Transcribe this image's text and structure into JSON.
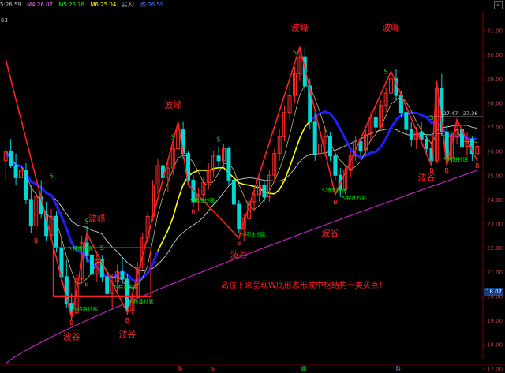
{
  "header": {
    "items": [
      {
        "label": "5:",
        "value": "26.59",
        "color": "#c8c8c8"
      },
      {
        "label": "M4:",
        "value": "26.07",
        "color": "#ff66ff"
      },
      {
        "label": "M5:",
        "value": "26.76",
        "color": "#00ff00"
      },
      {
        "label": "M6:",
        "value": "25.04",
        "color": "#ffff00"
      },
      {
        "label": "买入:",
        "value": "",
        "color": "#c8c8c8"
      },
      {
        "label": "跌:",
        "value": "26.59",
        "color": "#4d7dff"
      }
    ]
  },
  "corner_label": "63",
  "current_price_tag": "18.07",
  "colors": {
    "background": "#000000",
    "up_candle": "#ff2a2a",
    "down_candle": "#00d8d8",
    "zigzag": "#ff2020",
    "ma_blue": "#1e1eff",
    "ma_yellow": "#ffff00",
    "ma_white": "#cfcfcf",
    "ma_purple": "#c020c0",
    "annotation": "#ff2020",
    "signal_s": "#00ee00",
    "signal_b": "#ff3030"
  },
  "chart_data": {
    "type": "candlestick",
    "ylim": [
      17.4,
      31.8
    ],
    "yticks": [
      "31.00",
      "30.00",
      "29.00",
      "28.00",
      "27.00",
      "26.00",
      "25.00",
      "24.00",
      "23.00",
      "22.00",
      "21.00",
      "20.00",
      "19.00",
      "18.00",
      "17.00"
    ],
    "price_range_label": "27.47 - 27.36",
    "candles": [
      [
        25.6,
        26.2,
        24.8,
        26.0
      ],
      [
        26.0,
        26.5,
        25.3,
        25.4
      ],
      [
        25.4,
        25.9,
        24.6,
        24.9
      ],
      [
        24.9,
        25.4,
        24.2,
        25.2
      ],
      [
        25.2,
        25.5,
        23.8,
        24.0
      ],
      [
        24.0,
        24.6,
        22.6,
        22.9
      ],
      [
        22.9,
        24.4,
        22.7,
        24.1
      ],
      [
        24.1,
        24.8,
        23.2,
        23.4
      ],
      [
        23.4,
        23.9,
        22.3,
        22.5
      ],
      [
        22.5,
        23.6,
        22.4,
        23.3
      ],
      [
        23.3,
        23.5,
        21.8,
        22.0
      ],
      [
        22.0,
        22.4,
        20.6,
        20.8
      ],
      [
        20.8,
        21.5,
        19.5,
        19.7
      ],
      [
        19.7,
        20.1,
        19.0,
        19.3
      ],
      [
        19.3,
        20.9,
        19.2,
        20.7
      ],
      [
        20.7,
        22.5,
        20.5,
        22.2
      ],
      [
        22.2,
        22.9,
        21.4,
        21.7
      ],
      [
        21.7,
        22.0,
        20.7,
        20.9
      ],
      [
        20.9,
        21.8,
        20.6,
        21.5
      ],
      [
        21.5,
        21.7,
        20.6,
        20.8
      ],
      [
        20.8,
        21.0,
        19.9,
        20.1
      ],
      [
        20.1,
        20.9,
        19.5,
        20.6
      ],
      [
        20.6,
        21.3,
        20.2,
        21.0
      ],
      [
        21.0,
        21.6,
        20.5,
        20.7
      ],
      [
        20.7,
        20.9,
        19.2,
        19.4
      ],
      [
        19.4,
        20.2,
        19.2,
        20.0
      ],
      [
        20.0,
        21.4,
        19.9,
        21.2
      ],
      [
        21.2,
        22.6,
        21.1,
        22.4
      ],
      [
        22.4,
        23.5,
        22.2,
        23.3
      ],
      [
        23.3,
        24.8,
        23.1,
        24.6
      ],
      [
        24.6,
        25.7,
        24.2,
        25.4
      ],
      [
        25.4,
        26.1,
        24.6,
        24.9
      ],
      [
        24.9,
        25.6,
        24.3,
        25.3
      ],
      [
        25.3,
        26.4,
        25.0,
        26.1
      ],
      [
        26.1,
        27.1,
        25.8,
        26.9
      ],
      [
        26.9,
        27.2,
        25.7,
        25.9
      ],
      [
        25.9,
        26.0,
        24.6,
        24.8
      ],
      [
        24.8,
        25.0,
        23.7,
        23.9
      ],
      [
        23.9,
        24.5,
        23.5,
        24.2
      ],
      [
        24.2,
        24.9,
        23.9,
        24.7
      ],
      [
        24.7,
        25.5,
        24.4,
        25.2
      ],
      [
        25.2,
        26.0,
        24.9,
        25.8
      ],
      [
        25.8,
        26.2,
        25.3,
        25.6
      ],
      [
        25.6,
        26.3,
        25.4,
        26.1
      ],
      [
        26.1,
        26.2,
        24.6,
        24.8
      ],
      [
        24.8,
        24.9,
        23.6,
        23.8
      ],
      [
        23.8,
        24.0,
        22.6,
        22.8
      ],
      [
        22.8,
        23.4,
        22.3,
        23.2
      ],
      [
        23.2,
        24.1,
        23.0,
        23.9
      ],
      [
        23.9,
        24.4,
        23.5,
        24.2
      ],
      [
        24.2,
        24.9,
        23.9,
        24.6
      ],
      [
        24.6,
        24.8,
        23.9,
        24.1
      ],
      [
        24.1,
        25.2,
        23.9,
        25.0
      ],
      [
        25.0,
        26.1,
        24.8,
        25.9
      ],
      [
        25.9,
        26.9,
        25.6,
        26.6
      ],
      [
        26.6,
        27.9,
        26.4,
        27.6
      ],
      [
        27.6,
        28.6,
        27.3,
        28.3
      ],
      [
        28.3,
        29.5,
        28.0,
        29.2
      ],
      [
        29.2,
        30.2,
        28.9,
        29.9
      ],
      [
        29.9,
        30.3,
        28.4,
        28.7
      ],
      [
        28.7,
        29.0,
        26.9,
        27.2
      ],
      [
        27.2,
        27.6,
        25.6,
        25.9
      ],
      [
        25.9,
        26.6,
        25.4,
        26.3
      ],
      [
        26.3,
        26.9,
        25.8,
        26.6
      ],
      [
        26.6,
        26.8,
        25.6,
        25.8
      ],
      [
        25.8,
        25.9,
        24.8,
        25.0
      ],
      [
        25.0,
        25.3,
        24.1,
        24.4
      ],
      [
        24.4,
        25.4,
        24.2,
        25.2
      ],
      [
        25.2,
        26.0,
        24.9,
        25.8
      ],
      [
        25.8,
        26.6,
        25.6,
        26.4
      ],
      [
        26.4,
        26.5,
        25.8,
        26.0
      ],
      [
        26.0,
        26.9,
        25.8,
        26.7
      ],
      [
        26.7,
        27.6,
        26.4,
        27.4
      ],
      [
        27.4,
        27.8,
        26.8,
        27.0
      ],
      [
        27.0,
        28.1,
        26.9,
        27.9
      ],
      [
        27.9,
        28.6,
        27.6,
        28.4
      ],
      [
        28.4,
        29.3,
        28.1,
        29.0
      ],
      [
        29.0,
        29.4,
        28.1,
        28.3
      ],
      [
        28.3,
        28.5,
        27.4,
        27.6
      ],
      [
        27.6,
        27.9,
        26.7,
        26.9
      ],
      [
        26.9,
        27.2,
        26.2,
        26.5
      ],
      [
        26.5,
        27.0,
        26.1,
        26.8
      ],
      [
        26.8,
        27.2,
        26.3,
        26.5
      ],
      [
        26.5,
        26.7,
        25.9,
        26.1
      ],
      [
        26.1,
        26.4,
        25.4,
        25.6
      ],
      [
        25.6,
        28.9,
        25.5,
        28.6
      ],
      [
        28.6,
        29.2,
        26.6,
        26.8
      ],
      [
        26.8,
        27.1,
        25.4,
        25.7
      ],
      [
        25.7,
        26.8,
        25.5,
        26.6
      ],
      [
        26.6,
        27.3,
        26.3,
        26.9
      ],
      [
        26.9,
        27.0,
        26.0,
        26.2
      ],
      [
        26.2,
        26.8,
        25.8,
        26.5
      ],
      [
        26.5,
        26.6,
        25.6,
        25.9
      ],
      [
        25.9,
        26.4,
        25.6,
        26.2
      ]
    ],
    "annotations": [
      {
        "text": "波峰",
        "color": "#ff2020"
      },
      {
        "text": "波峰",
        "color": "#ff2020"
      },
      {
        "text": "波峰",
        "color": "#ff2020"
      },
      {
        "text": "波峰",
        "color": "#ff2020"
      },
      {
        "text": "波谷",
        "color": "#ff2020"
      },
      {
        "text": "波谷",
        "color": "#ff2020"
      },
      {
        "text": "波谷",
        "color": "#ff2020"
      },
      {
        "text": "波谷",
        "color": "#ff2020"
      },
      {
        "text": "波谷",
        "color": "#ff2020"
      },
      {
        "text": "高位下来呈现W底形态形成中枢结构一类买点！",
        "color": "#ff2020"
      }
    ],
    "signals": [
      "S",
      "S",
      "S",
      "S",
      "S",
      "S",
      "S",
      "S",
      "B",
      "B",
      "B",
      "B",
      "B",
      "B",
      "B",
      "B",
      "B",
      "B"
    ],
    "signal_texts": [
      "特准抄底",
      "特准抄底",
      "特准抄底",
      "特准抄底",
      "特准抄底",
      "特准抄底",
      "特准抄底",
      "特准抄底",
      "特准抄底"
    ],
    "bottom_markers": [
      {
        "text": "涨",
        "color": "#ff3030"
      },
      {
        "text": "$",
        "color": "#ff3030"
      },
      {
        "text": "闻",
        "color": "#00ee00"
      },
      {
        "text": "胜",
        "color": "#5a8cff"
      }
    ]
  }
}
